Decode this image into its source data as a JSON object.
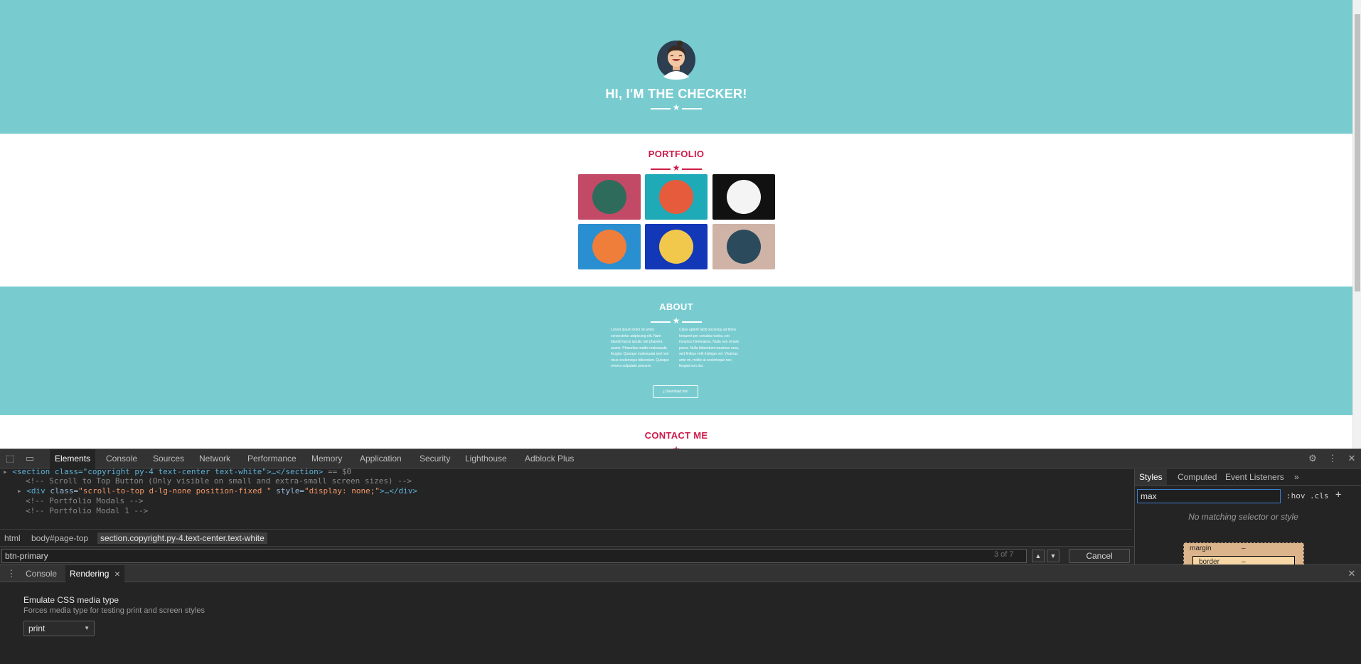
{
  "page": {
    "masthead_title": "HI, I'M THE CHECKER!",
    "portfolio_title": "PORTFOLIO",
    "about_title": "ABOUT",
    "about_col1": "Lorem ipsum dolor sit amet, consectetur adipiscing elit. Nam blandit turpis iaculis nisl pharetra auctor. Phasellus mattis malesuada feugiat. Quisque malesuada sed non risus scelerisque bibendum. Quisque viverra vulputate posuere.",
    "about_col2": "Class aptent taciti sociosqu ad litora torquent per conubia nostra, per inceptos himenaeos. Nulla non ornare purus. Nulla bibendum maximus urna, sed finibus velit tristique vel. Vivamus ante mi, mollis at scelerisque nec, feugiat non dui.",
    "download_label": "Download me!",
    "contact_title": "CONTACT ME",
    "colors": {
      "teal": "#78ccd0",
      "accent": "#cf1a4a"
    },
    "portfolio_tiles": [
      {
        "name": "cabin",
        "bg": "#c24a66",
        "disc": "#2f6b5a"
      },
      {
        "name": "cake",
        "bg": "#1faab8",
        "disc": "#e55b3c"
      },
      {
        "name": "circus-tent",
        "bg": "#111111",
        "disc": "#f4f4f4"
      },
      {
        "name": "game-controller",
        "bg": "#2a8fd0",
        "disc": "#ef7e3b"
      },
      {
        "name": "safe",
        "bg": "#1238b8",
        "disc": "#f1c84c"
      },
      {
        "name": "submarine",
        "bg": "#cfb3a6",
        "disc": "#2b4a5c"
      }
    ]
  },
  "devtools": {
    "tabs": [
      "Elements",
      "Console",
      "Sources",
      "Network",
      "Performance",
      "Memory",
      "Application",
      "Security",
      "Lighthouse",
      "Adblock Plus"
    ],
    "code": {
      "line0_tag": "<section class=\"copyright py-4 text-center text-white\">…</section>",
      "line0_eq": " == $0",
      "line1": "<!-- Scroll to Top Button (Only visible on small and extra-small screen sizes) -->",
      "line2_open": "<div",
      "line2_attr1": " class=",
      "line2_val1": "\"scroll-to-top d-lg-none position-fixed \"",
      "line2_attr2": " style=",
      "line2_val2": "\"display: none;\"",
      "line2_close": ">…</div>",
      "line3": "<!-- Portfolio Modals -->",
      "line4": "<!-- Portfolio Modal 1 -->"
    },
    "breadcrumbs": [
      "html",
      "body#page-top",
      "section.copyright.py-4.text-center.text-white"
    ],
    "search_value": "btn-primary",
    "search_count": "3 of 7",
    "cancel_label": "Cancel",
    "styles_tabs": [
      "Styles",
      "Computed",
      "Event Listeners"
    ],
    "more_tabs": "»",
    "filter_value": "max",
    "hov_label": ":hov",
    "cls_label": ".cls",
    "add_label": "+",
    "no_match": "No matching selector or style",
    "boxmodel_margin": "margin",
    "boxmodel_margin_value": "–",
    "boxmodel_border": "border",
    "boxmodel_border_value": "–",
    "drawer_tabs": [
      "Console",
      "Rendering"
    ],
    "rendering_title": "Emulate CSS media type",
    "rendering_desc": "Forces media type for testing print and screen styles",
    "media_value": "print"
  }
}
